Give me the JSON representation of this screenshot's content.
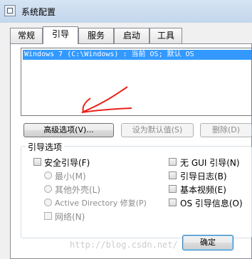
{
  "window": {
    "title": "系统配置"
  },
  "tabs": [
    {
      "label": "常规"
    },
    {
      "label": "引导"
    },
    {
      "label": "服务"
    },
    {
      "label": "启动"
    },
    {
      "label": "工具"
    }
  ],
  "os_list": {
    "items": [
      "Windows 7 (C:\\Windows) : 当前 OS; 默认 OS"
    ]
  },
  "buttons": {
    "advanced": "高级选项(V)...",
    "set_default": "设为默认值(S)",
    "delete": "删除(D)",
    "ok": "确定"
  },
  "boot_options": {
    "group_label": "引导选项",
    "safe_boot": "安全引导(F)",
    "minimal": "最小(M)",
    "alternate_shell": "其他外壳(L)",
    "active_directory_repair": "Active Directory 修复(P)",
    "network": "网络(N)",
    "no_gui_boot": "无 GUI 引导(N)",
    "boot_log": "引导日志(B)",
    "base_video": "基本视频(E)",
    "os_boot_info": "OS 引导信息(O)"
  },
  "watermark": "http://blog.csdn.net/"
}
